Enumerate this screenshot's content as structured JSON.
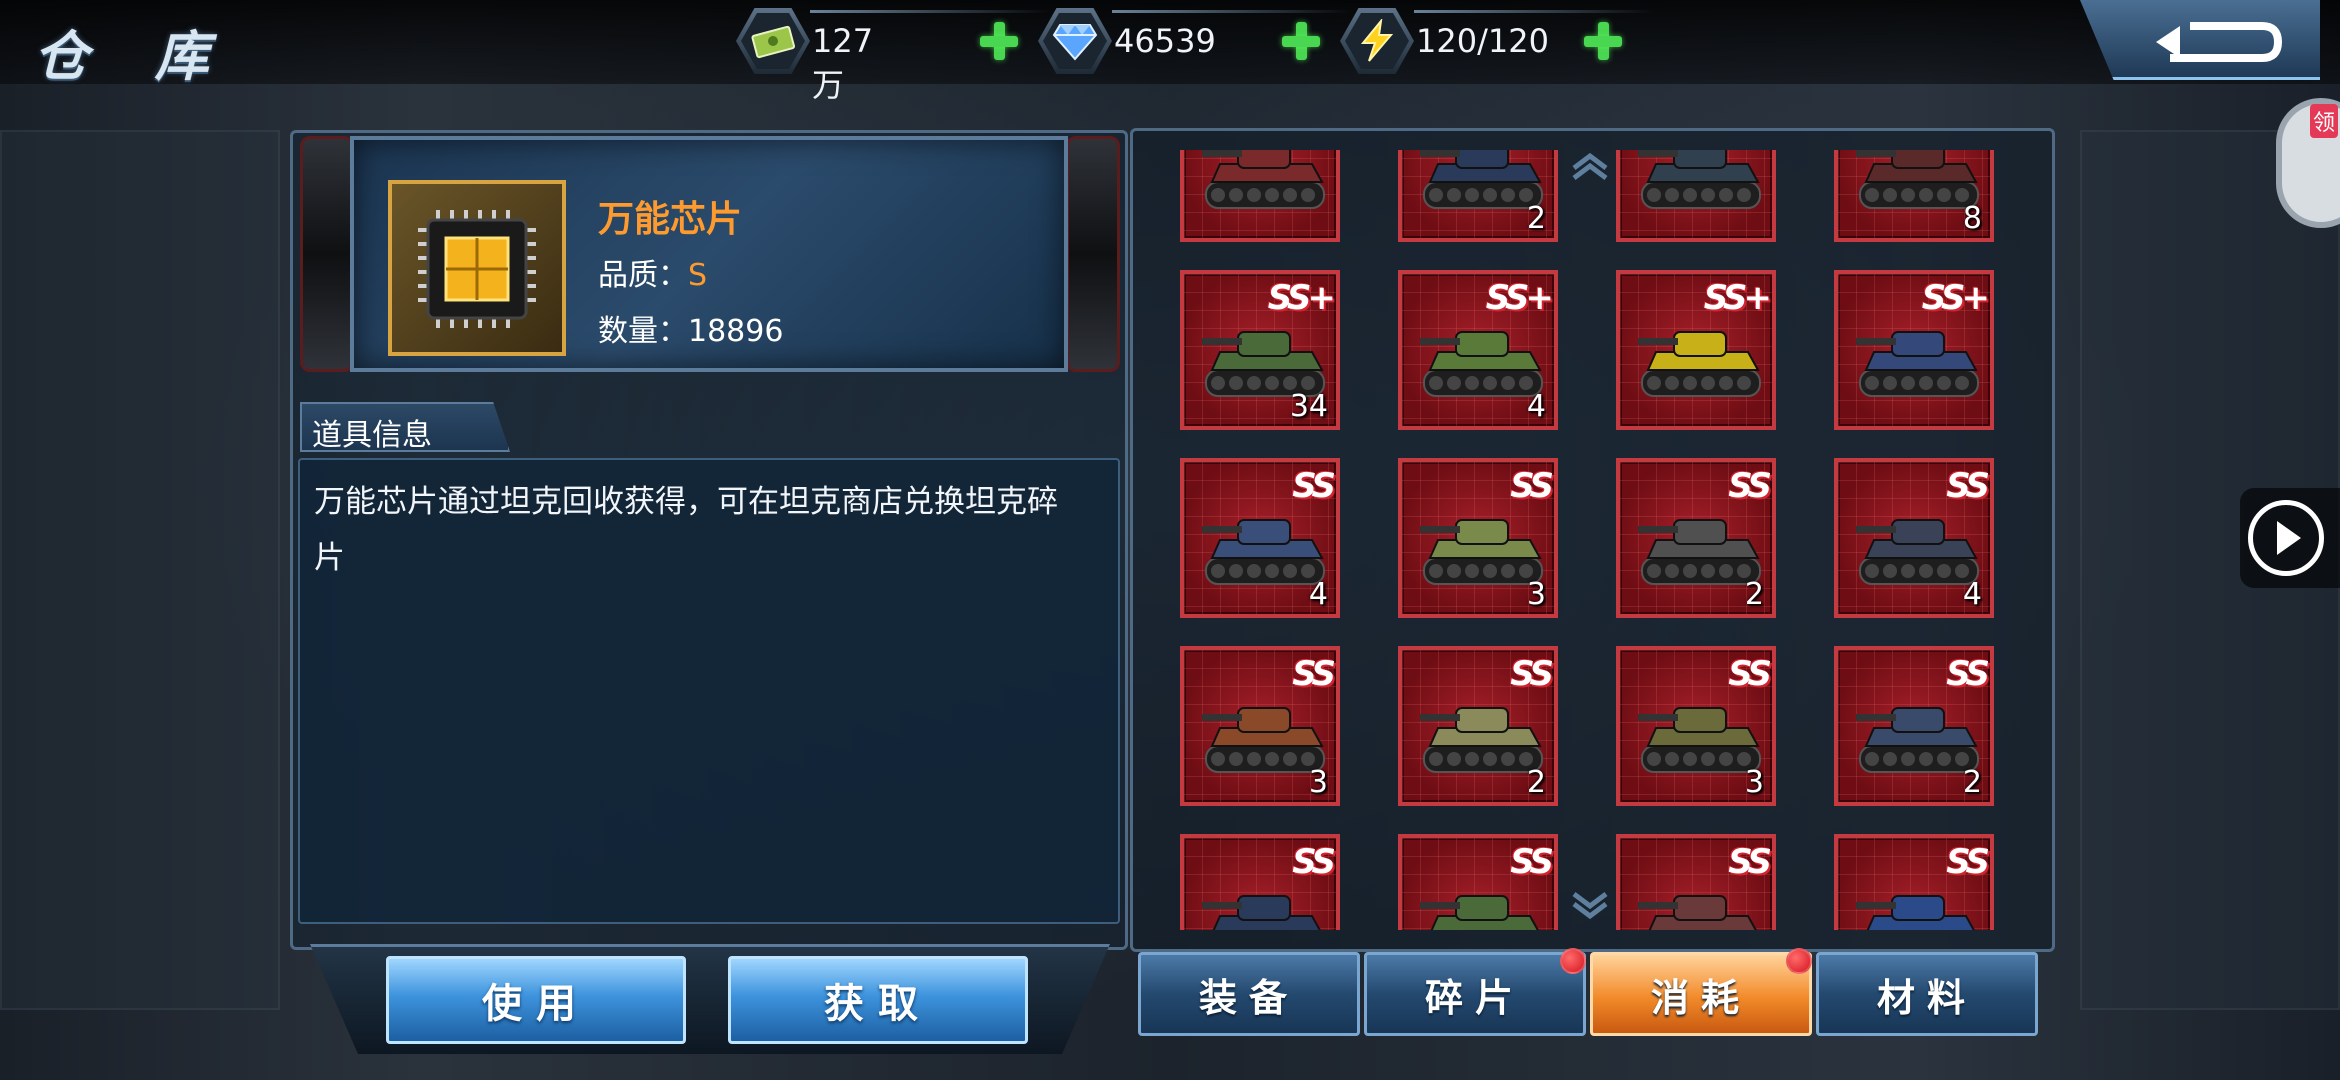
{
  "title": "仓 库",
  "resources": [
    {
      "icon": "cash-icon",
      "value": "127万"
    },
    {
      "icon": "diamond-icon",
      "value": "46539"
    },
    {
      "icon": "energy-icon",
      "value": "120/120"
    }
  ],
  "item": {
    "name": "万能芯片",
    "quality_label": "品质：",
    "quality_value": "S",
    "count_label": "数量：",
    "count_value": "18896",
    "icon": "chip-icon"
  },
  "info": {
    "tab_label": "道具信息",
    "description_line1": "万能芯片通过坦克回收获得，可在坦克商店兑换坦克碎",
    "description_line2": "片"
  },
  "actions": {
    "use_label": "使用",
    "get_label": "获取"
  },
  "grid": {
    "rows": [
      [
        {
          "rank": "",
          "count": ""
        },
        {
          "rank": "",
          "count": "2"
        },
        {
          "rank": "",
          "count": ""
        },
        {
          "rank": "",
          "count": "8"
        }
      ],
      [
        {
          "rank": "SS+",
          "count": "34"
        },
        {
          "rank": "SS+",
          "count": "4"
        },
        {
          "rank": "SS+",
          "count": ""
        },
        {
          "rank": "SS+",
          "count": ""
        }
      ],
      [
        {
          "rank": "SS",
          "count": "4"
        },
        {
          "rank": "SS",
          "count": "3"
        },
        {
          "rank": "SS",
          "count": "2"
        },
        {
          "rank": "SS",
          "count": "4"
        }
      ],
      [
        {
          "rank": "SS",
          "count": "3"
        },
        {
          "rank": "SS",
          "count": "2"
        },
        {
          "rank": "SS",
          "count": "3"
        },
        {
          "rank": "SS",
          "count": "2"
        }
      ],
      [
        {
          "rank": "SS",
          "count": ""
        },
        {
          "rank": "SS",
          "count": ""
        },
        {
          "rank": "SS",
          "count": ""
        },
        {
          "rank": "SS",
          "count": ""
        }
      ]
    ],
    "tank_colors": [
      [
        "#7a2a2a",
        "#2a3a5a",
        "#30404e",
        "#5a2a2a"
      ],
      [
        "#4a6a3a",
        "#5a7a3a",
        "#c8b018",
        "#34487a"
      ],
      [
        "#3a4e7a",
        "#7a8a4a",
        "#505050",
        "#3a4258"
      ],
      [
        "#8a4a2a",
        "#8a8a5a",
        "#6a6a3a",
        "#3a4a6a"
      ],
      [
        "#2a3a5a",
        "#4a6a3a",
        "#6a3a3a",
        "#2a4a8a"
      ]
    ]
  },
  "tabs": [
    {
      "label": "装备",
      "active": false,
      "dot": false
    },
    {
      "label": "碎片",
      "active": false,
      "dot": true
    },
    {
      "label": "消耗",
      "active": true,
      "dot": true
    },
    {
      "label": "材料",
      "active": false,
      "dot": false
    }
  ],
  "side": {
    "gift_label": "领"
  },
  "colors": {
    "accent_orange": "#ff9b2e",
    "plus_green": "#49d650",
    "cell_red": "#a8202a"
  }
}
